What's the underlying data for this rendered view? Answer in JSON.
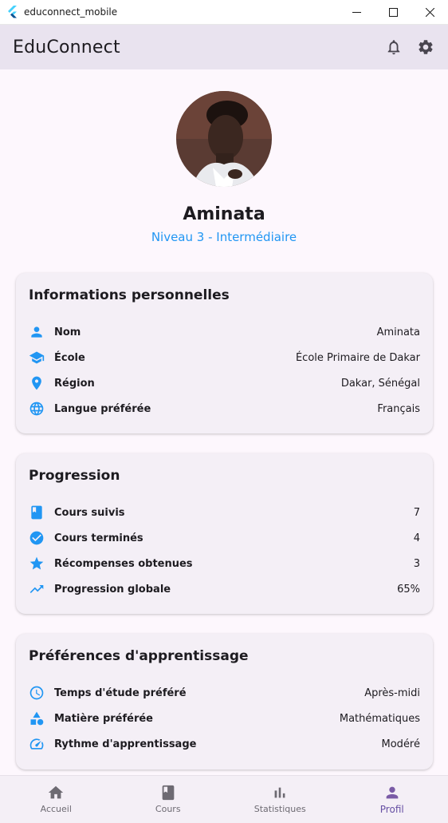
{
  "window": {
    "title": "educonnect_mobile"
  },
  "appbar": {
    "title": "EduConnect"
  },
  "profile": {
    "name": "Aminata",
    "level": "Niveau 3 - Intermédiaire"
  },
  "personal": {
    "title": "Informations personnelles",
    "rows": [
      {
        "icon": "person-icon",
        "label": "Nom",
        "value": "Aminata"
      },
      {
        "icon": "school-icon",
        "label": "École",
        "value": "École Primaire de Dakar"
      },
      {
        "icon": "location-pin-icon",
        "label": "Région",
        "value": "Dakar, Sénégal"
      },
      {
        "icon": "globe-icon",
        "label": "Langue préférée",
        "value": "Français"
      }
    ]
  },
  "progress": {
    "title": "Progression",
    "rows": [
      {
        "icon": "book-icon",
        "label": "Cours suivis",
        "value": "7"
      },
      {
        "icon": "check-circle-icon",
        "label": "Cours terminés",
        "value": "4"
      },
      {
        "icon": "star-icon",
        "label": "Récompenses obtenues",
        "value": "3"
      },
      {
        "icon": "trending-up-icon",
        "label": "Progression globale",
        "value": "65%"
      }
    ]
  },
  "preferences": {
    "title": "Préférences d'apprentissage",
    "rows": [
      {
        "icon": "clock-icon",
        "label": "Temps d'étude préféré",
        "value": "Après-midi"
      },
      {
        "icon": "category-shapes-icon",
        "label": "Matière préférée",
        "value": "Mathématiques"
      },
      {
        "icon": "speed-icon",
        "label": "Rythme d'apprentissage",
        "value": "Modéré"
      }
    ]
  },
  "nav": {
    "items": [
      {
        "icon": "home-icon",
        "label": "Accueil"
      },
      {
        "icon": "book-icon",
        "label": "Cours"
      },
      {
        "icon": "bar-chart-icon",
        "label": "Statistiques"
      },
      {
        "icon": "person-icon",
        "label": "Profil"
      }
    ],
    "active": "Profil"
  },
  "colors": {
    "accent": "#2196f3",
    "appbar_bg": "#e9e3ef",
    "card_bg": "#f4eff6",
    "page_bg": "#fdf7fd",
    "nav_active": "#6750a4"
  }
}
